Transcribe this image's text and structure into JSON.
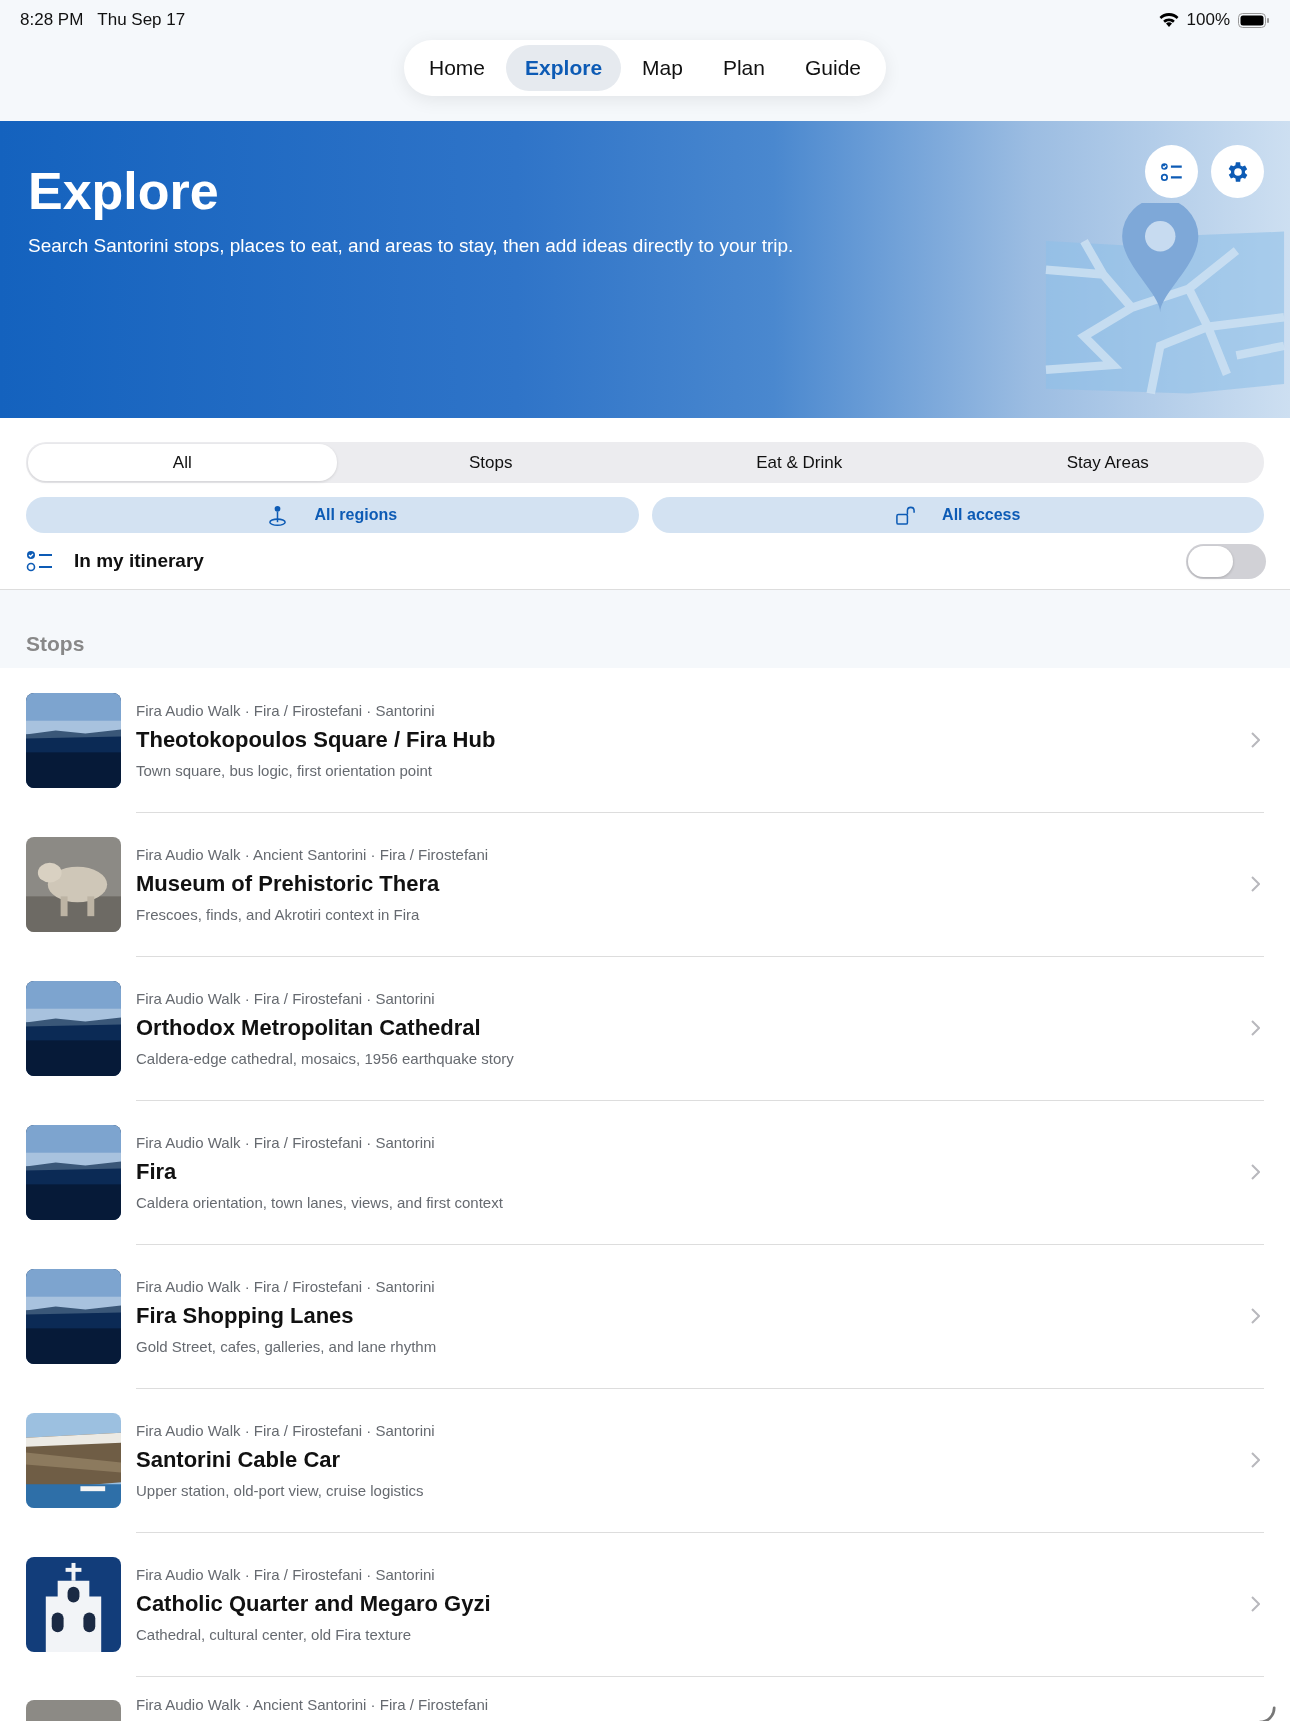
{
  "status_bar": {
    "time": "8:28 PM",
    "date": "Thu Sep 17",
    "battery": "100%"
  },
  "nav_tabs": [
    {
      "label": "Home",
      "selected": false
    },
    {
      "label": "Explore",
      "selected": true
    },
    {
      "label": "Map",
      "selected": false
    },
    {
      "label": "Plan",
      "selected": false
    },
    {
      "label": "Guide",
      "selected": false
    }
  ],
  "header": {
    "title": "Explore",
    "subtitle": "Search Santorini stops, places to eat, and areas to stay, then add ideas directly to your trip."
  },
  "segments": [
    {
      "label": "All",
      "selected": true
    },
    {
      "label": "Stops",
      "selected": false
    },
    {
      "label": "Eat & Drink",
      "selected": false
    },
    {
      "label": "Stay Areas",
      "selected": false
    }
  ],
  "filters": [
    {
      "label": "All regions",
      "kind": "region"
    },
    {
      "label": "All access",
      "kind": "access"
    }
  ],
  "itinerary_toggle": {
    "label": "In my itinerary",
    "on": false
  },
  "section_title": "Stops",
  "stops": [
    {
      "meta": "Fira Audio Walk · Fira / Firostefani · Santorini",
      "title": "Theotokopoulos Square / Fira Hub",
      "subtitle": "Town square, bus logic, first orientation point"
    },
    {
      "meta": "Fira Audio Walk · Ancient Santorini · Fira / Firostefani",
      "title": "Museum of Prehistoric Thera",
      "subtitle": "Frescoes, finds, and Akrotiri context in Fira"
    },
    {
      "meta": "Fira Audio Walk · Fira / Firostefani · Santorini",
      "title": "Orthodox Metropolitan Cathedral",
      "subtitle": "Caldera-edge cathedral, mosaics, 1956 earthquake story"
    },
    {
      "meta": "Fira Audio Walk · Fira / Firostefani · Santorini",
      "title": "Fira",
      "subtitle": "Caldera orientation, town lanes, views, and first context"
    },
    {
      "meta": "Fira Audio Walk · Fira / Firostefani · Santorini",
      "title": "Fira Shopping Lanes",
      "subtitle": "Gold Street, cafes, galleries, and lane rhythm"
    },
    {
      "meta": "Fira Audio Walk · Fira / Firostefani · Santorini",
      "title": "Santorini Cable Car",
      "subtitle": "Upper station, old-port view, cruise logistics"
    },
    {
      "meta": "Fira Audio Walk · Fira / Firostefani · Santorini",
      "title": "Catholic Quarter and Megaro Gyzi",
      "subtitle": "Cathedral, cultural center, old Fira texture"
    },
    {
      "meta": "Fira Audio Walk · Ancient Santorini · Fira / Firostefani"
    }
  ]
}
